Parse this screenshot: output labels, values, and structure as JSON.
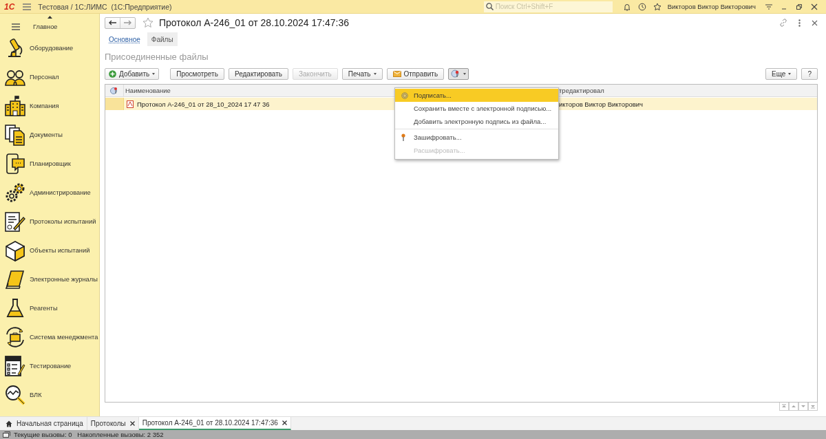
{
  "top_bar": {
    "logo": "1С",
    "title": "Тестовая / 1С:ЛИМС  (1С:Предприятие)",
    "search": {
      "placeholder": "Поиск Ctrl+Shift+F"
    },
    "user": "Викторов Виктор Викторович"
  },
  "sidebar": {
    "items": [
      {
        "label": "Главное",
        "selected": false
      },
      {
        "label": "Оборудование",
        "selected": false
      },
      {
        "label": "Персонал",
        "selected": false
      },
      {
        "label": "Компания",
        "selected": false
      },
      {
        "label": "Документы",
        "selected": false
      },
      {
        "label": "Планировщик",
        "selected": false
      },
      {
        "label": "Администрирование",
        "selected": false
      },
      {
        "label": "Протоколы испытаний",
        "selected": false
      },
      {
        "label": "Объекты испытаний",
        "selected": false
      },
      {
        "label": "Электронные журналы",
        "selected": false
      },
      {
        "label": "Реагенты",
        "selected": false
      },
      {
        "label": "Система менеджмента",
        "selected": false
      },
      {
        "label": "Тестирование",
        "selected": false
      },
      {
        "label": "ВЛК",
        "selected": false
      }
    ]
  },
  "form": {
    "title": "Протокол А-246_01 от 28.10.2024 17:47:36",
    "tabs": [
      {
        "label": "Основное",
        "selected": false
      },
      {
        "label": "Файлы",
        "selected": true
      }
    ],
    "section_title": "Присоединенные файлы",
    "toolbar": [
      {
        "kind": "add",
        "label": "Добавить",
        "dropdown": true,
        "disabled": false
      },
      {
        "kind": "plain",
        "label": "Просмотреть",
        "dropdown": false,
        "disabled": false
      },
      {
        "kind": "plain",
        "label": "Редактировать",
        "dropdown": false,
        "disabled": false
      },
      {
        "kind": "plain",
        "label": "Закончить",
        "dropdown": false,
        "disabled": true
      },
      {
        "kind": "plain",
        "label": "Печать",
        "dropdown": true,
        "disabled": false
      },
      {
        "kind": "send",
        "label": "Отправить",
        "dropdown": false,
        "disabled": false
      },
      {
        "kind": "signature",
        "dropdown": true,
        "disabled": false,
        "pressed": true
      }
    ],
    "more_button": "Еще",
    "help_button": "?",
    "table": {
      "columns": [
        "Наименование",
        "тредактировал"
      ],
      "rows": [
        {
          "name": "Протокол А-246_01 от 28_10_2024 17 47 36",
          "editor": "икторов Виктор Викторович",
          "selected": true
        }
      ]
    },
    "menu": [
      {
        "kind": "item",
        "label": "Подписать...",
        "icon": true,
        "selected": true,
        "disabled": false
      },
      {
        "kind": "item",
        "label": "Сохранить вместе с электронной подписью...",
        "icon": false,
        "selected": false,
        "disabled": false
      },
      {
        "kind": "item",
        "label": "Добавить электронную подпись из файла...",
        "icon": false,
        "selected": false,
        "disabled": false
      },
      {
        "kind": "separator"
      },
      {
        "kind": "item",
        "label": "Зашифровать...",
        "icon": true,
        "selected": false,
        "disabled": false
      },
      {
        "kind": "item",
        "label": "Расшифровать...",
        "icon": false,
        "selected": false,
        "disabled": true
      }
    ]
  },
  "open_tabs": [
    {
      "label": "Начальная страница",
      "home": true,
      "closable": false,
      "selected": false
    },
    {
      "label": "Протоколы",
      "home": false,
      "closable": true,
      "selected": false
    },
    {
      "label": "Протокол А-246_01 от 28.10.2024 17:47:36",
      "home": false,
      "closable": true,
      "selected": true
    }
  ],
  "status_bar": "Текущие вызовы: 0   Накопленные вызовы: 2 352"
}
